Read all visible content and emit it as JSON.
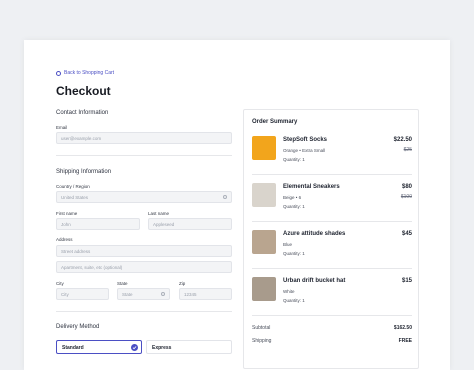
{
  "back_link": "Back to Shopping Cart",
  "page_title": "Checkout",
  "contact": {
    "heading": "Contact Information",
    "email_label": "Email",
    "email_placeholder": "user@example.com"
  },
  "shipping": {
    "heading": "Shipping Information",
    "country_label": "Country / Region",
    "country_value": "United States",
    "first_name_label": "First name",
    "first_name_placeholder": "John",
    "last_name_label": "Last name",
    "last_name_placeholder": "Appleseed",
    "address_label": "Address",
    "street_placeholder": "Street address",
    "apt_placeholder": "Apartment, suite, etc (optional)",
    "city_label": "City",
    "city_placeholder": "City",
    "state_label": "State",
    "state_placeholder": "State",
    "zip_label": "Zip",
    "zip_placeholder": "12345"
  },
  "delivery": {
    "heading": "Delivery Method",
    "options": [
      "Standard",
      "Express"
    ]
  },
  "summary": {
    "title": "Order Summary",
    "items": [
      {
        "name": "StepSoft Socks",
        "variant": "Orange • Extra Small",
        "qty": "Quantity: 1",
        "price": "$22.50",
        "old_price": "$25",
        "color": "#f2a51c"
      },
      {
        "name": "Elemental Sneakers",
        "variant": "Beige • 6",
        "qty": "Quantity: 1",
        "price": "$80",
        "old_price": "$100",
        "color": "#d9d4cc"
      },
      {
        "name": "Azure attitude shades",
        "variant": "Blue",
        "qty": "Quantity: 1",
        "price": "$45",
        "old_price": "",
        "color": "#b9a58f"
      },
      {
        "name": "Urban drift bucket hat",
        "variant": "White",
        "qty": "Quantity: 1",
        "price": "$15",
        "old_price": "",
        "color": "#a89b8c"
      }
    ],
    "subtotal_label": "Subtotal",
    "subtotal_value": "$162.50",
    "shipping_label": "Shipping",
    "shipping_value": "FREE"
  }
}
